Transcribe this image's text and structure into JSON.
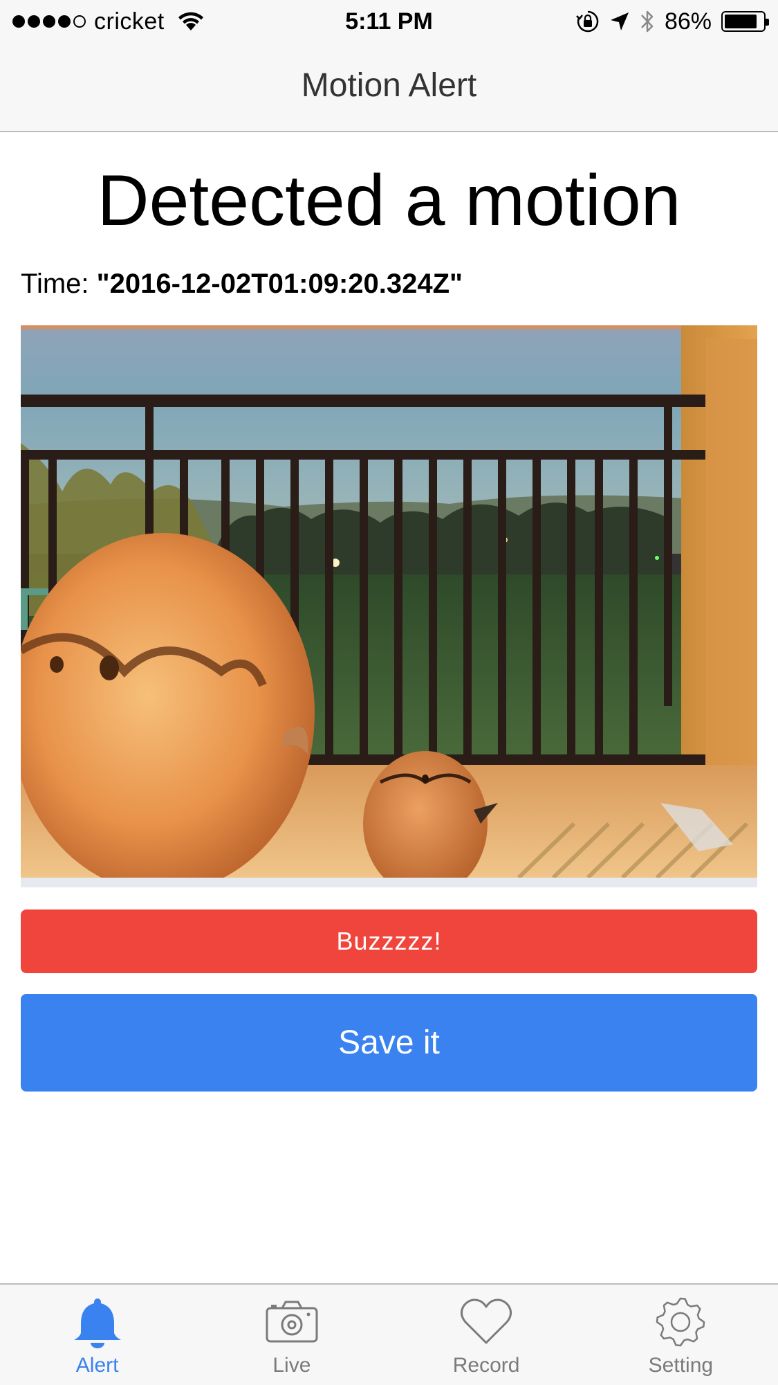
{
  "status_bar": {
    "carrier": "cricket",
    "time": "5:11 PM",
    "battery_percent": "86%",
    "battery_level": 0.86,
    "signal_bars": 4,
    "signal_total": 5,
    "icons": [
      "wifi-icon",
      "rotation-lock-icon",
      "location-arrow-icon",
      "bluetooth-icon",
      "battery-icon"
    ]
  },
  "nav": {
    "title": "Motion Alert"
  },
  "alert": {
    "heading": "Detected a motion",
    "time_label": "Time: ",
    "time_value": "\"2016-12-02T01:09:20.324Z\""
  },
  "buttons": {
    "buzz_label": "Buzzzzz!",
    "save_label": "Save it"
  },
  "colors": {
    "buzz": "#ef453c",
    "save": "#3a82f0",
    "tab_active": "#3a82f0",
    "tab_inactive": "#7a7a7a"
  },
  "tabs": [
    {
      "label": "Alert",
      "icon": "bell-icon",
      "active": true
    },
    {
      "label": "Live",
      "icon": "camera-icon",
      "active": false
    },
    {
      "label": "Record",
      "icon": "heart-icon",
      "active": false
    },
    {
      "label": "Setting",
      "icon": "gear-icon",
      "active": false
    }
  ]
}
